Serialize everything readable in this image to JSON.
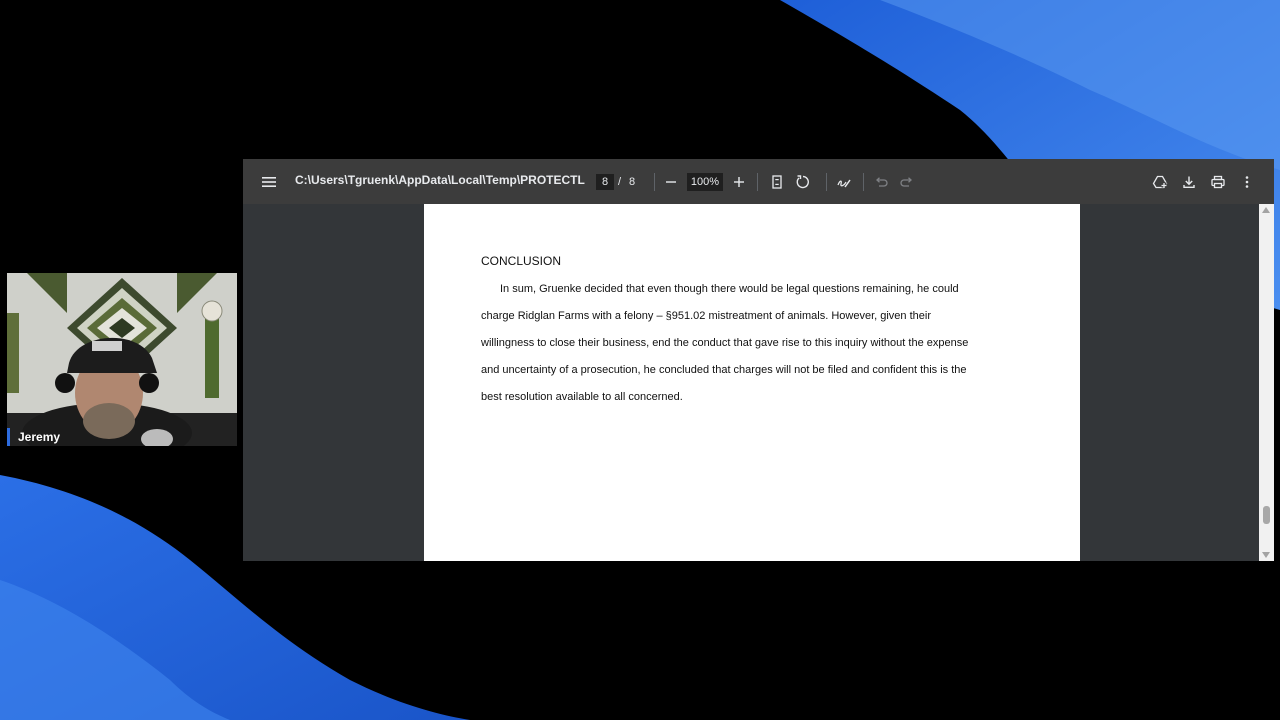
{
  "viewer": {
    "file_path": "C:\\Users\\Tgruenk\\AppData\\Local\\Temp\\PROTECTLoca...",
    "page_current": "8",
    "page_separator": "/",
    "page_total": "8",
    "zoom": "100%",
    "icons": {
      "menu": "menu-icon",
      "zoom_out": "minus-icon",
      "zoom_in": "plus-icon",
      "fit": "fit-page-icon",
      "rotate": "rotate-icon",
      "annotate": "draw-icon",
      "undo": "undo-icon",
      "redo": "redo-icon",
      "drive": "drive-icon",
      "download": "download-icon",
      "print": "print-icon",
      "more": "more-vert-icon"
    }
  },
  "document": {
    "heading": "CONCLUSION",
    "lines": [
      "In sum, Gruenke decided that even though there would be legal questions remaining, he could",
      "charge Ridglan Farms  with a felony – §951.02  mistreatment of animals.  However, given their",
      "willingness to close their business,  end the conduct that gave rise to this inquiry without the expense",
      "and uncertainty of a prosecution, he concluded that charges will not be filed and confident this is the",
      "best resolution available to all concerned."
    ]
  },
  "webcam": {
    "name": "Jeremy"
  },
  "colors": {
    "wave_blue": "#2f6fe0",
    "toolbar": "#3c3c3c",
    "viewer_bg": "#333639"
  }
}
